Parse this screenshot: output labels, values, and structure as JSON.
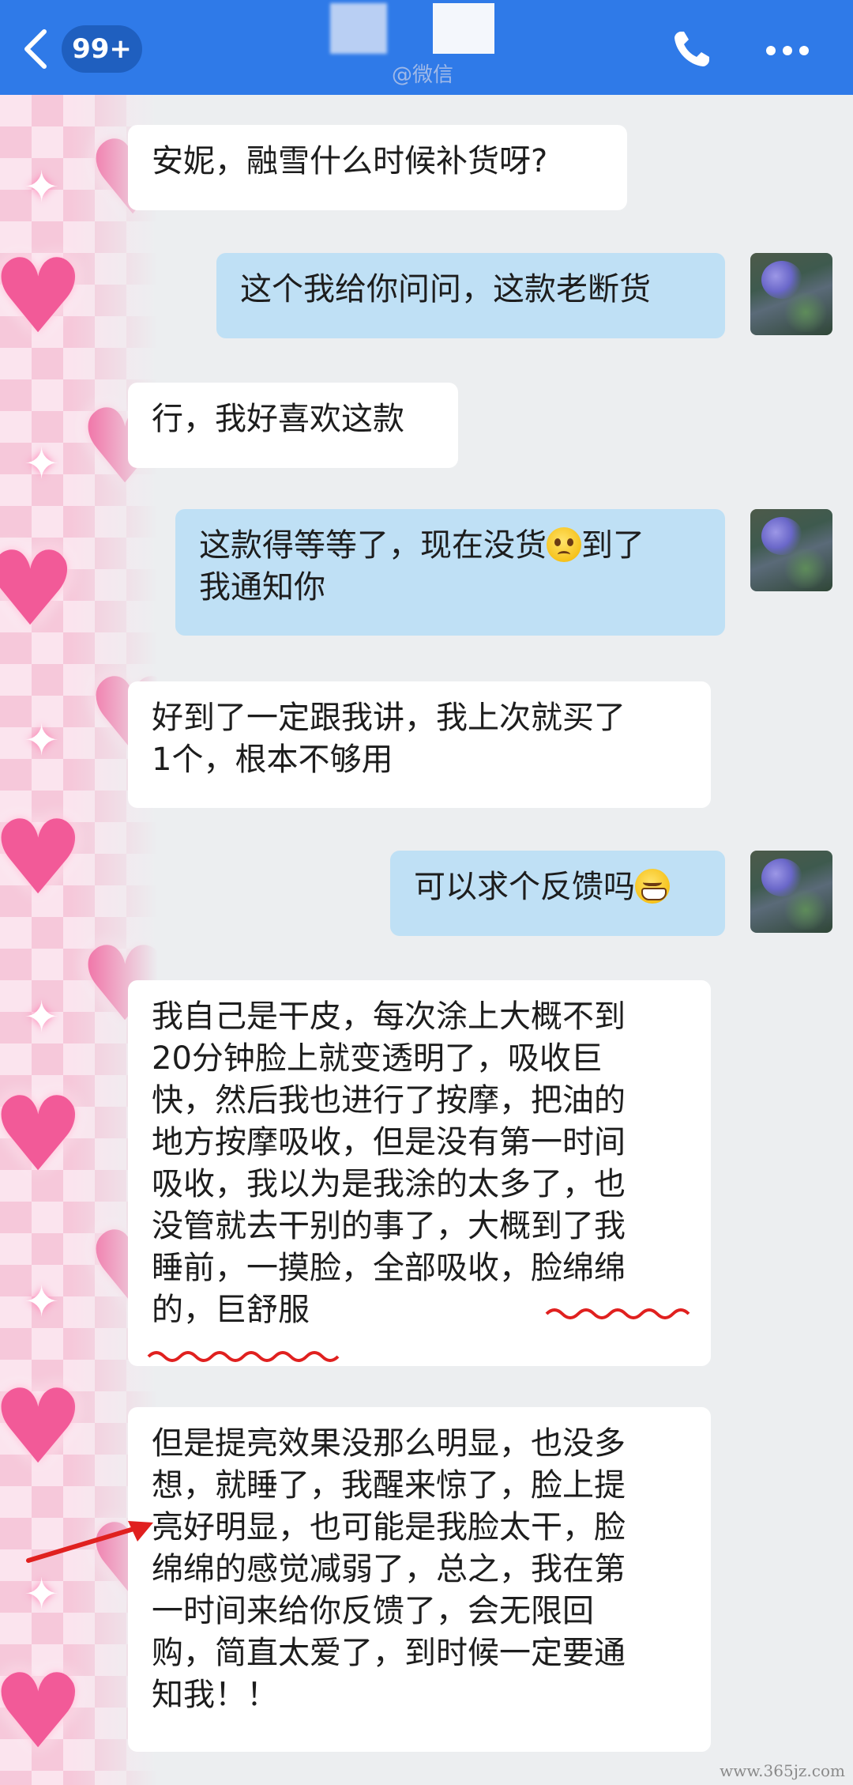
{
  "header": {
    "unread_badge": "99+",
    "wechat_tag": "@微信",
    "back_icon": "chevron-left-icon",
    "call_icon": "phone-icon",
    "more_icon": "more-icon",
    "bar_color": "#2f7ae8"
  },
  "messages": [
    {
      "side": "in",
      "text": "安妮，融雪什么时候补货呀?"
    },
    {
      "side": "out",
      "text": "这个我给你问问，这款老断货"
    },
    {
      "side": "in",
      "text": "行，我好喜欢这款"
    },
    {
      "side": "out",
      "text_line1_a": "这款得等等了，现在没货",
      "text_line1_b": "到了",
      "text_line2": "我通知你"
    },
    {
      "side": "in",
      "lines": [
        "好到了一定跟我讲，我上次就买了",
        "1个，根本不够用"
      ]
    },
    {
      "side": "out",
      "text": "可以求个反馈吗"
    },
    {
      "side": "in",
      "lines": [
        "我自己是干皮，每次涂上大概不到",
        "20分钟脸上就变透明了，吸收巨",
        "快，然后我也进行了按摩，把油的",
        "地方按摩吸收，但是没有第一时间",
        "吸收，我以为是我涂的太多了，也",
        "没管就去干别的事了，大概到了我",
        "睡前，一摸脸，全部吸收，脸绵绵",
        "的，巨舒服"
      ]
    },
    {
      "side": "in",
      "lines": [
        "但是提亮效果没那么明显，也没多",
        "想，就睡了，我醒来惊了，脸上提",
        "亮好明显，也可能是我脸太干，脸",
        "绵绵的感觉减弱了，总之，我在第",
        "一时间来给你反馈了，会无限回",
        "购，简直太爱了，到时候一定要通",
        "知我！！"
      ]
    }
  ],
  "watermark": "www.365jz.com"
}
